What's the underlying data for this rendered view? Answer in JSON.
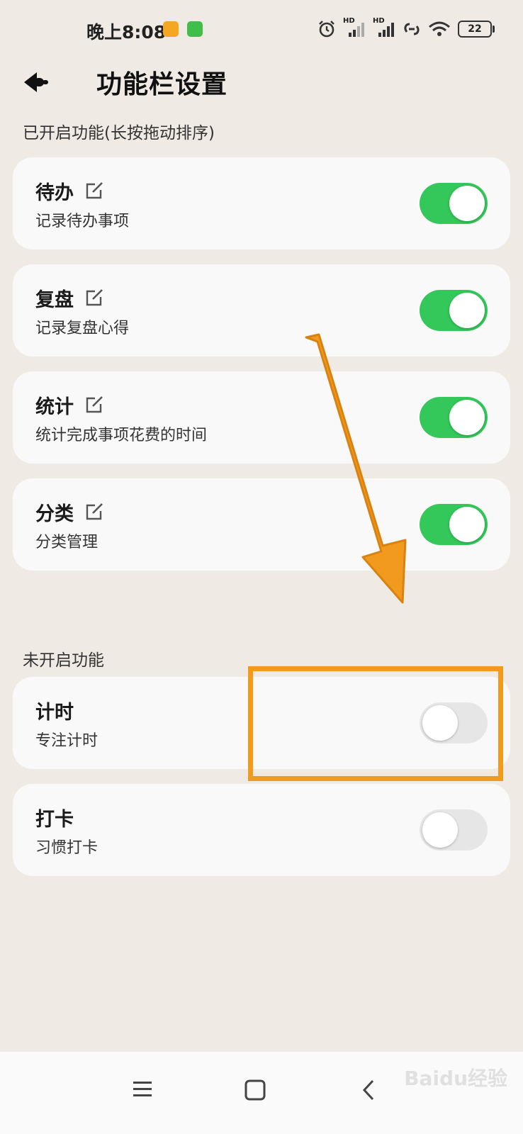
{
  "status_bar": {
    "time": "晚上8:08",
    "battery": "22",
    "network_1": "HD",
    "network_2": "HD"
  },
  "header": {
    "title": "功能栏设置"
  },
  "enabled_section": {
    "label": "已开启功能(长按拖动排序)",
    "items": [
      {
        "title": "待办",
        "subtitle": "记录待办事项",
        "enabled": true
      },
      {
        "title": "复盘",
        "subtitle": "记录复盘心得",
        "enabled": true
      },
      {
        "title": "统计",
        "subtitle": "统计完成事项花费的时间",
        "enabled": true
      },
      {
        "title": "分类",
        "subtitle": "分类管理",
        "enabled": true
      }
    ]
  },
  "disabled_section": {
    "label": "未开启功能",
    "items": [
      {
        "title": "计时",
        "subtitle": "专注计时",
        "enabled": false
      },
      {
        "title": "打卡",
        "subtitle": "习惯打卡",
        "enabled": false
      }
    ]
  },
  "colors": {
    "toggle_on": "#34c759",
    "toggle_off": "#e6e6e6",
    "annotation": "#f29a1e",
    "background": "#efebe4"
  },
  "watermark": "Baidu经验"
}
